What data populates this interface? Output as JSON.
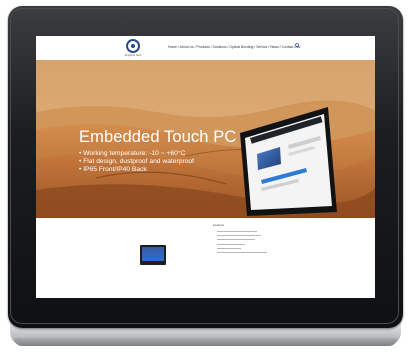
{
  "brand": {
    "logo_text": "KingSoul Tech"
  },
  "nav": {
    "menu_text": "Home / About Us / Products / Solutions / Optical Bonding / Service / News / Contact Us /"
  },
  "hero": {
    "title": "Embedded Touch PC",
    "features": [
      "• Working temperature: -10 ~ +60°C",
      "• Flat design, dustproof and waterproof",
      "• IP65 Front/IP40 Back"
    ]
  },
  "specs": {
    "title": "Features"
  },
  "colors": {
    "bezel": "#1c1d1f",
    "chassis": "#d4d6d8",
    "accent": "#2a4a8c"
  },
  "icons": {
    "search": "search-icon",
    "logo": "brand-logo-icon"
  }
}
